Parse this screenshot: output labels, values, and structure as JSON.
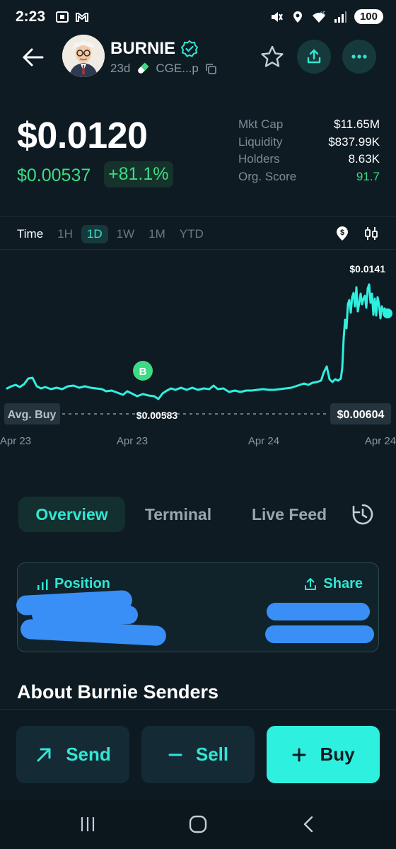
{
  "status": {
    "time": "2:23",
    "battery": "100",
    "network": "6E"
  },
  "token": {
    "name": "BURNIE",
    "age": "23d",
    "address": "CGE...p"
  },
  "price": {
    "current": "$0.0120",
    "change_abs": "$0.00537",
    "change_pct": "+81.1%"
  },
  "stats": [
    {
      "label": "Mkt Cap",
      "value": "$11.65M"
    },
    {
      "label": "Liquidity",
      "value": "$837.99K"
    },
    {
      "label": "Holders",
      "value": "8.63K"
    },
    {
      "label": "Org. Score",
      "value": "91.7"
    }
  ],
  "timeframe": {
    "label": "Time",
    "options": [
      "1H",
      "1D",
      "1W",
      "1M",
      "YTD"
    ],
    "selected": "1D"
  },
  "chart": {
    "high_label": "$0.0141",
    "avg_buy_label": "Avg. Buy",
    "avg_buy_value": "$0.00583",
    "current_value": "$0.00604",
    "buy_marker": "B",
    "x_labels": [
      "Apr 23",
      "Apr 23",
      "Apr 24",
      "Apr 24"
    ]
  },
  "tabs": [
    "Overview",
    "Terminal",
    "Live Feed"
  ],
  "position": {
    "title": "Position",
    "share": "Share"
  },
  "about_title": "About Burnie Senders",
  "actions": {
    "send": "Send",
    "sell": "Sell",
    "buy": "Buy"
  },
  "colors": {
    "background": "#0f1b23",
    "accent": "#33e5d2",
    "positive": "#3ddc84",
    "buy_button": "#2ef0de",
    "redaction": "#3a8ff7"
  }
}
